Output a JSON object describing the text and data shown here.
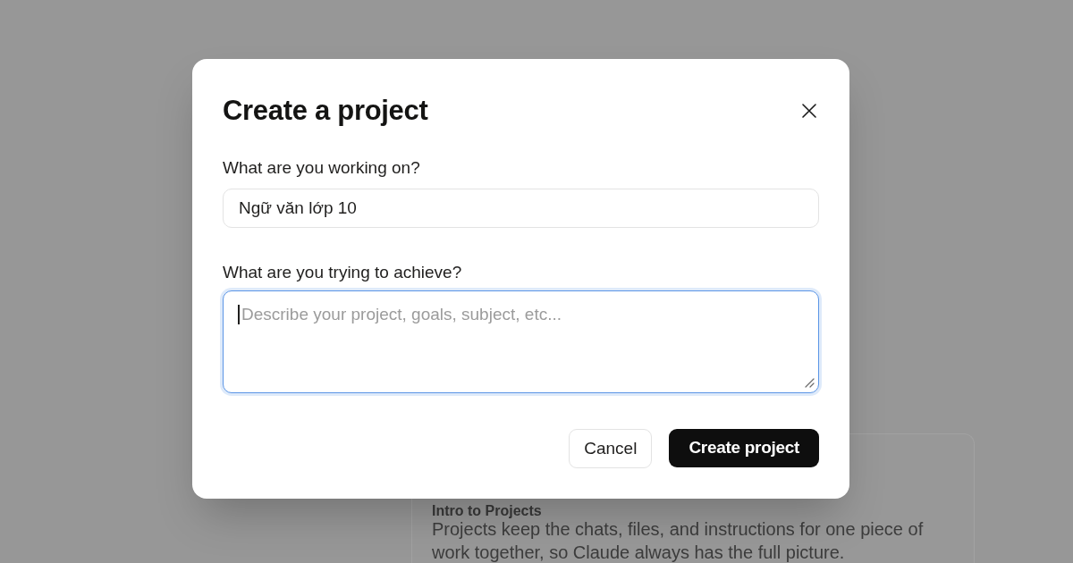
{
  "dialog": {
    "title": "Create a project",
    "fields": [
      {
        "kind": "input",
        "label": "What are you working on?",
        "value": "Ngữ văn lớp 10",
        "focused": false
      },
      {
        "kind": "textarea",
        "label": "What are you trying to achieve?",
        "placeholder": "Describe your project, goals, subject, etc...",
        "focused": true
      }
    ],
    "buttons": [
      {
        "kind": "secondary",
        "label": "Cancel"
      },
      {
        "kind": "primary",
        "label": "Create project"
      }
    ]
  },
  "background": {
    "intro_card": {
      "title": "Intro to Projects",
      "text": "Projects keep the chats, files, and instructions for one piece of work together, so Claude always has the full picture."
    }
  }
}
